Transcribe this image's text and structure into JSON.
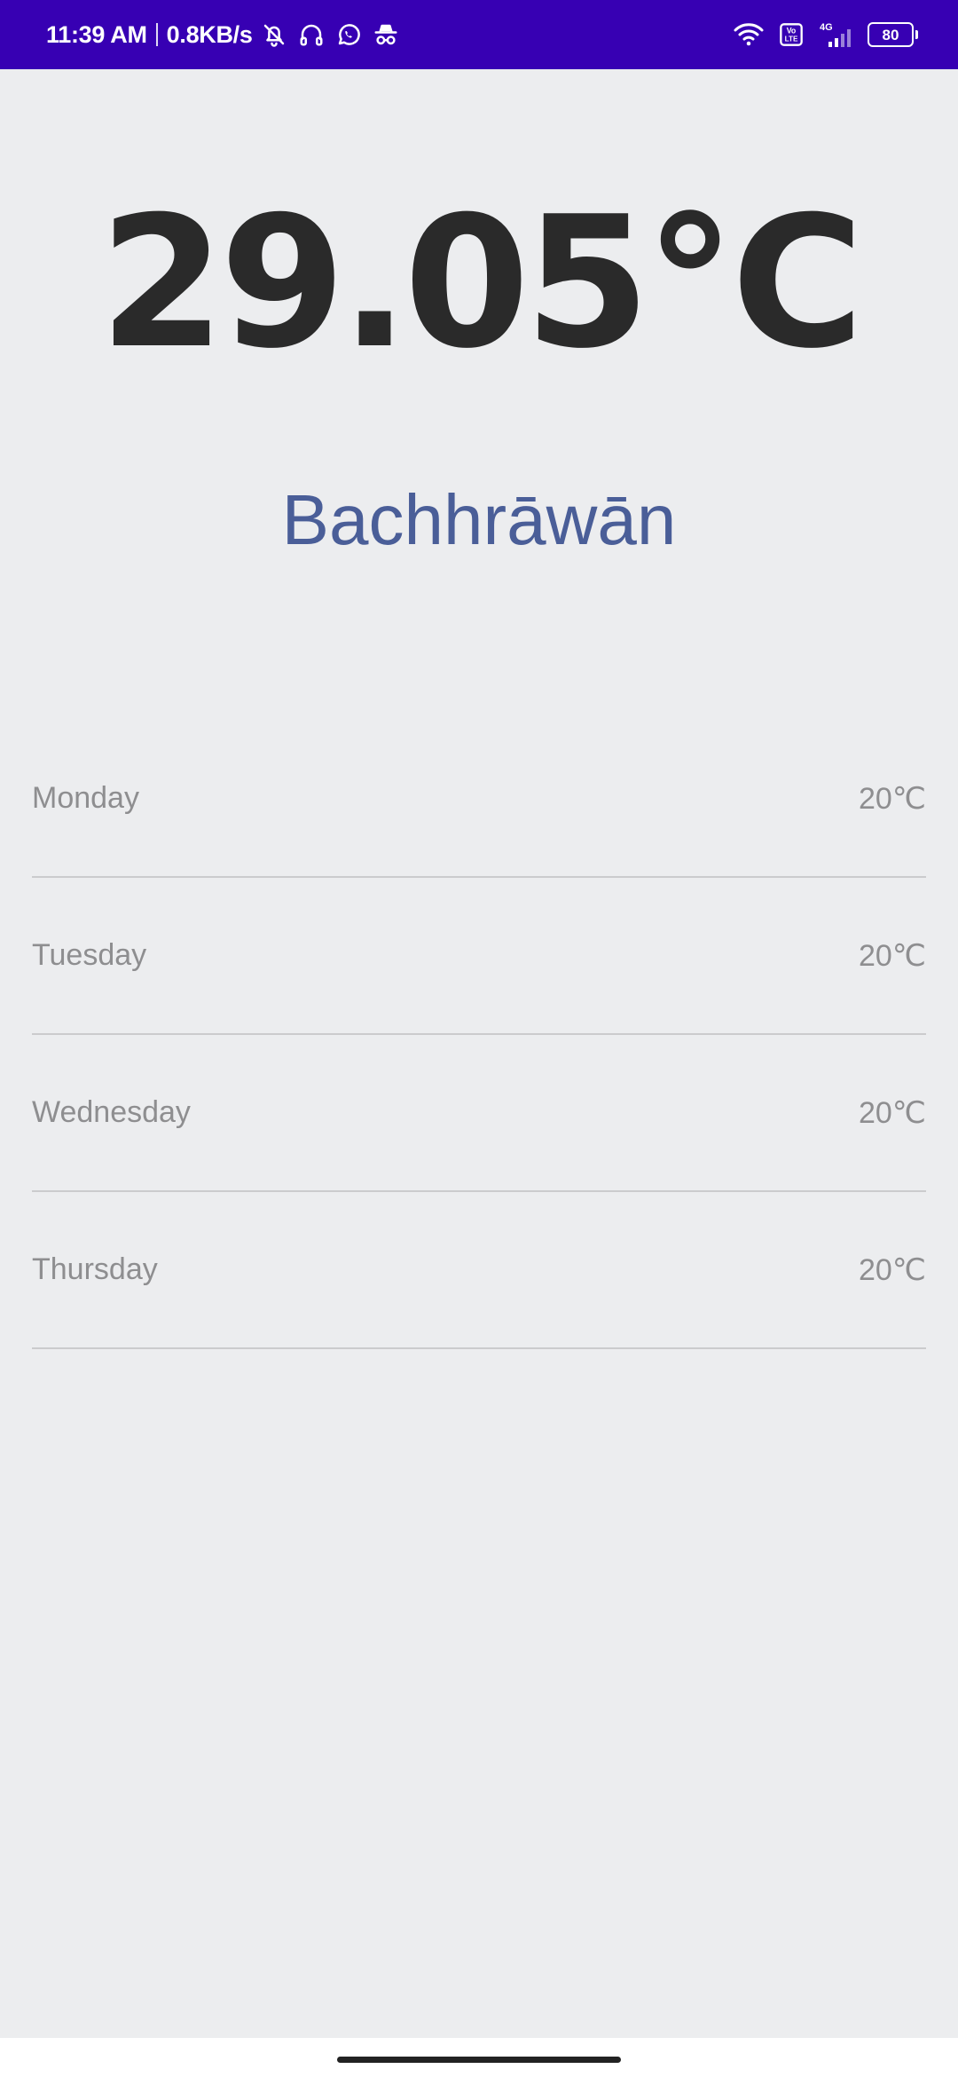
{
  "status_bar": {
    "time": "11:39 AM",
    "network_speed": "0.8KB/s",
    "battery_level": "80",
    "signal_label": "4G",
    "volte_label": "Vo LTE",
    "left_icons": [
      "bell-off-icon",
      "headphones-icon",
      "whatsapp-icon",
      "incognito-icon"
    ],
    "right_icons": [
      "wifi-icon",
      "volte-icon",
      "signal-4g-icon",
      "battery-icon"
    ],
    "background_color": "#3700B3"
  },
  "weather": {
    "current_temperature": "29.05℃",
    "city": "Bachhrāwān"
  },
  "forecast": [
    {
      "day": "Monday",
      "temperature": "20℃"
    },
    {
      "day": "Tuesday",
      "temperature": "20℃"
    },
    {
      "day": "Wednesday",
      "temperature": "20℃"
    },
    {
      "day": "Thursday",
      "temperature": "20℃"
    }
  ],
  "colors": {
    "background": "#ECEDEF",
    "temperature_text": "#2A2A2A",
    "city_text": "#4A5E98",
    "forecast_text": "#8E8E90",
    "divider": "#CBCBCD"
  }
}
